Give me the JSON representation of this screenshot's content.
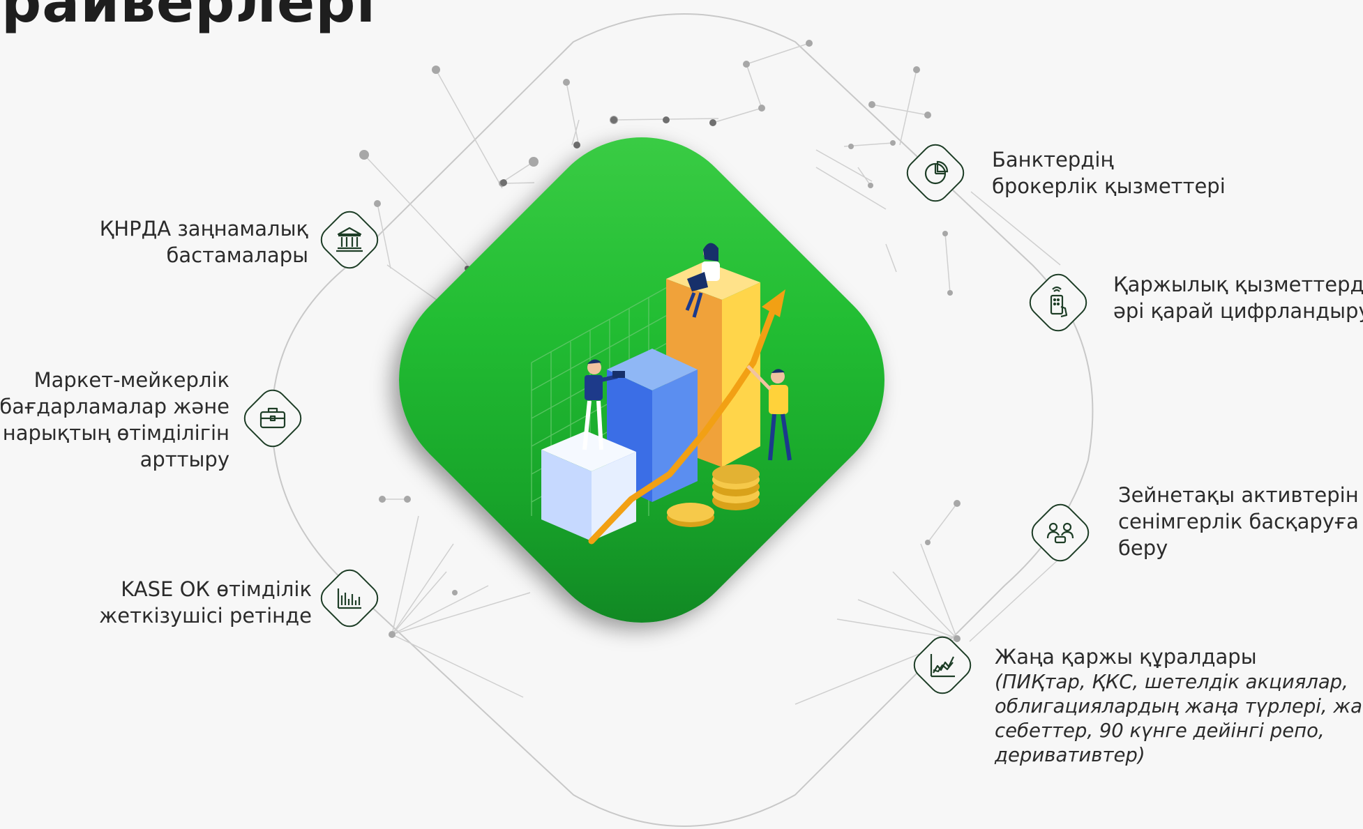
{
  "title": "райверлері",
  "labels": {
    "knrda": [
      "ҚНРДА заңнамалық",
      "бастамалары"
    ],
    "market_making": [
      "Маркет-мейкерлік",
      "бағдарламалар және",
      "нарықтың өтімділігін",
      "арттыру"
    ],
    "kase": [
      "KASE ОК өтімділік",
      "жеткізушісі ретінде"
    ],
    "banks": [
      "Банктердің",
      "брокерлік қызметтері"
    ],
    "digital": [
      "Қаржылық қызметтерді",
      "әрі қарай цифрландыру"
    ],
    "pension": [
      "Зейнетақы активтерін",
      "сенімгерлік басқаруға",
      "беру"
    ],
    "instruments": {
      "heading": "Жаңа қаржы құралдары",
      "detail": [
        "(ПИҚтар, ҚКС, шетелдік акциялар,",
        "облигациялардың жаңа түрлері, жаңа",
        "себеттер, 90 күнге дейінгі репо,",
        "деривативтер)"
      ]
    }
  },
  "icons": {
    "knrda": "bank-building-icon",
    "market_making": "briefcase-icon",
    "kase": "bar-chart-icon",
    "banks": "pie-chart-icon",
    "digital": "smartphone-hand-icon",
    "pension": "people-handshake-icon",
    "instruments": "line-chart-icon"
  },
  "colors": {
    "green_dark": "#0f7f22",
    "green_light": "#3fcf48",
    "icon_stroke": "#1d3d26",
    "text": "#2b2b2b",
    "background": "#f7f7f7"
  }
}
